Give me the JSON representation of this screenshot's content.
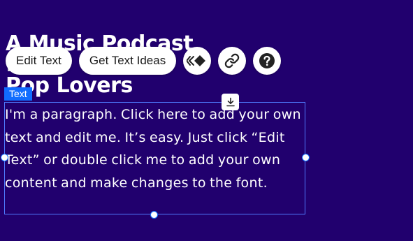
{
  "heading": {
    "text": "A Music Podcast for\nPop Lovers"
  },
  "toolbar": {
    "edit_text_label": "Edit Text",
    "get_ideas_label": "Get Text Ideas",
    "animation_icon": "animation-icon",
    "link_icon": "link-icon",
    "help_icon": "help-icon"
  },
  "element_tag": {
    "label": "Text"
  },
  "paragraph": {
    "text": "I'm a paragraph. Click here to add your own text and edit me. It’s easy. Just click “Edit Text” or double click me to add your own content and make changes to the font."
  },
  "colors": {
    "background": "#21006e",
    "selection": "#116dff",
    "toolbar_bg": "#ffffff"
  }
}
